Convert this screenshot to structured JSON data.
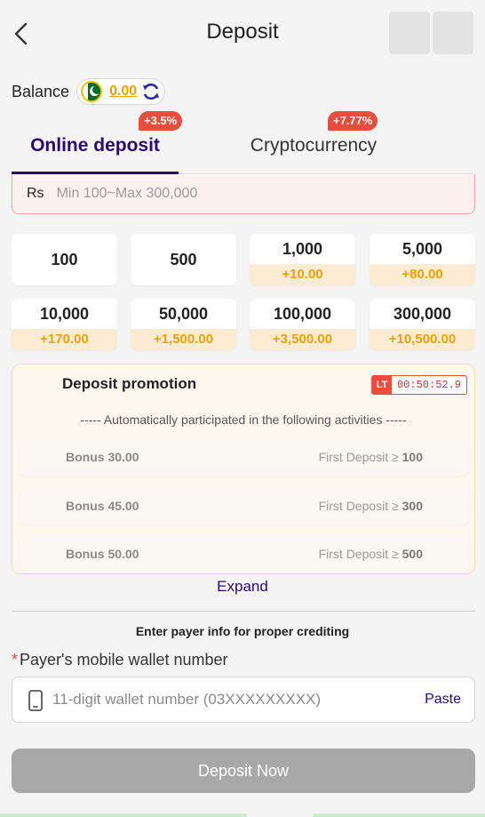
{
  "header": {
    "title": "Deposit"
  },
  "balance": {
    "label": "Balance",
    "value": "0.00"
  },
  "tabs": [
    {
      "label": "Online deposit",
      "badge": "+3.5%",
      "active": true
    },
    {
      "label": "Cryptocurrency",
      "badge": "+7.77%",
      "active": false
    }
  ],
  "amount": {
    "currency": "Rs",
    "placeholder": "Min 100~Max 300,000"
  },
  "chips": [
    {
      "value": "100",
      "bonus": ""
    },
    {
      "value": "500",
      "bonus": ""
    },
    {
      "value": "1,000",
      "bonus": "+10.00"
    },
    {
      "value": "5,000",
      "bonus": "+80.00"
    },
    {
      "value": "10,000",
      "bonus": "+170.00"
    },
    {
      "value": "50,000",
      "bonus": "+1,500.00"
    },
    {
      "value": "100,000",
      "bonus": "+3,500.00"
    },
    {
      "value": "300,000",
      "bonus": "+10,500.00"
    }
  ],
  "promotion": {
    "title": "Deposit promotion",
    "timer_tag": "LT",
    "timer": "00:50:52.9",
    "subtitle": "----- Automatically participated in the following activities -----",
    "rows": [
      {
        "bonus": "Bonus 30.00",
        "condition": "First Deposit ≥",
        "amount": "100"
      },
      {
        "bonus": "Bonus 45.00",
        "condition": "First Deposit ≥",
        "amount": "300"
      },
      {
        "bonus": "Bonus 50.00",
        "condition": "First Deposit ≥",
        "amount": "500"
      }
    ],
    "expand_label": "Expand"
  },
  "payer": {
    "hint": "Enter payer info for proper crediting",
    "required_mark": "*",
    "label": "Payer's mobile wallet number",
    "placeholder": "11-digit wallet number (03XXXXXXXXX)",
    "paste_label": "Paste"
  },
  "submit": {
    "label": "Deposit Now"
  },
  "colors": {
    "accent": "#2a0a6e",
    "badge": "#e84d3d",
    "bonus": "#f0a000",
    "disabled": "#a8a8a8"
  }
}
